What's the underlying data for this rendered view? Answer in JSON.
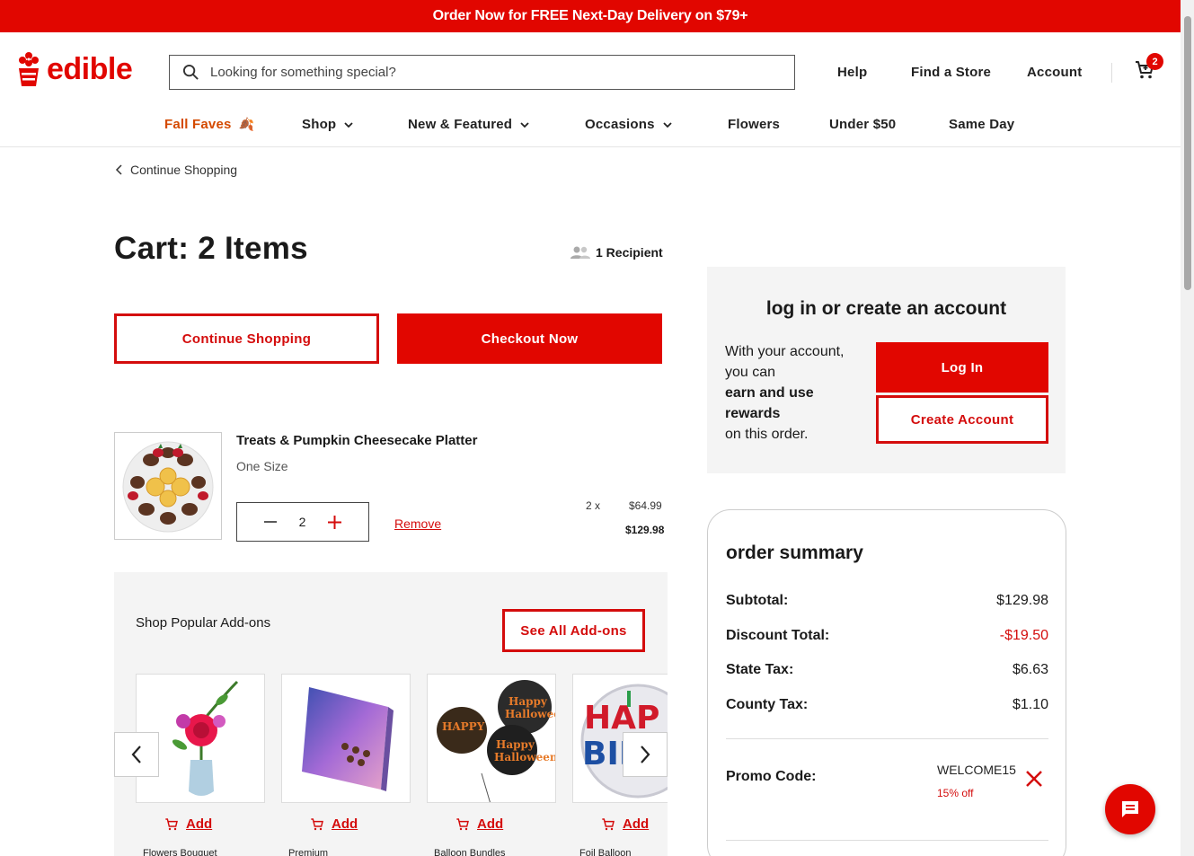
{
  "promo_bar": {
    "text": "Order Now for FREE Next-Day Delivery on $79+"
  },
  "header": {
    "logo_text": "edible",
    "search_placeholder": "Looking for something special?",
    "links": {
      "help": "Help",
      "find_store": "Find a Store",
      "account": "Account"
    },
    "cart_count": "2"
  },
  "nav": {
    "fall_faves": "Fall Faves",
    "fall_faves_emoji": "🍂",
    "shop": "Shop",
    "new_featured": "New & Featured",
    "occasions": "Occasions",
    "flowers": "Flowers",
    "under_50": "Under $50",
    "same_day": "Same Day"
  },
  "cart": {
    "back_link": "Continue Shopping",
    "title": "Cart: 2 Items",
    "recipients": "1 Recipient",
    "continue_btn": "Continue Shopping",
    "checkout_btn": "Checkout Now",
    "item": {
      "name": "Treats & Pumpkin Cheesecake Platter",
      "size": "One Size",
      "quantity": "2",
      "remove": "Remove",
      "unit_count": "2 x",
      "unit_price": "$64.99",
      "line_total": "$129.98"
    }
  },
  "addons": {
    "title": "Shop Popular Add-ons",
    "see_all": "See All Add-ons",
    "add_label": "Add",
    "cards": [
      {
        "name": "Flowers Bouquet"
      },
      {
        "name": "Premium"
      },
      {
        "name": "Balloon Bundles"
      },
      {
        "name": "Foil Balloon"
      }
    ]
  },
  "login": {
    "title": "log in or create an account",
    "text_1": "With your account, you can",
    "text_bold": "earn and use rewards",
    "text_2": "on this order.",
    "login_btn": "Log In",
    "create_btn": "Create Account"
  },
  "summary": {
    "title": "order summary",
    "rows": [
      {
        "label": "Subtotal:",
        "value": "$129.98"
      },
      {
        "label": "Discount Total:",
        "value": "-$19.50"
      },
      {
        "label": "State Tax:",
        "value": "$6.63"
      },
      {
        "label": "County Tax:",
        "value": "$1.10"
      }
    ],
    "promo_label": "Promo Code:",
    "promo_code": "WELCOME15",
    "promo_discount": "15% off"
  },
  "colors": {
    "brand_red": "#e10600",
    "accent_red": "#d40c0c",
    "fall_orange": "#d44a00"
  }
}
